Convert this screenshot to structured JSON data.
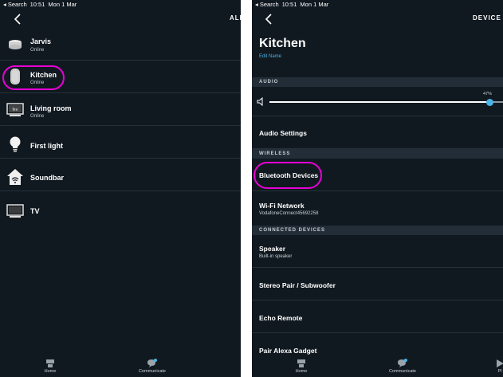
{
  "status_bar": {
    "carrier": "◂ Search",
    "time": "10:51",
    "date": "Mon 1 Mar"
  },
  "left": {
    "header_action": "ALL",
    "devices": [
      {
        "name": "Jarvis",
        "status": "Online",
        "icon": "echo-dot-icon"
      },
      {
        "name": "Kitchen",
        "status": "Online",
        "icon": "echo-speaker-icon"
      },
      {
        "name": "Living room",
        "status": "Online",
        "icon": "fire-tv-icon"
      },
      {
        "name": "First light",
        "status": "",
        "icon": "light-bulb-icon"
      },
      {
        "name": "Soundbar",
        "status": "",
        "icon": "home-wifi-icon"
      },
      {
        "name": "TV",
        "status": "",
        "icon": "tv-icon"
      }
    ]
  },
  "right": {
    "header_action": "DEVICE S",
    "title": "Kitchen",
    "edit_name": "Edit Name",
    "audio_section": "AUDIO",
    "volume": {
      "value": 47,
      "label": "47%"
    },
    "audio_settings": "Audio Settings",
    "wireless_section": "WIRELESS",
    "bluetooth": "Bluetooth Devices",
    "wifi": {
      "label": "Wi-Fi Network",
      "network": "VodafoneConnect45692258"
    },
    "connected_section": "CONNECTED DEVICES",
    "speaker": {
      "label": "Speaker",
      "sub": "Built-in speaker"
    },
    "stereo": "Stereo Pair / Subwoofer",
    "echo_remote": "Echo Remote",
    "pair_gadget": "Pair Alexa Gadget"
  },
  "tabs": {
    "home": "Home",
    "communicate": "Communicate",
    "play_partial": "Pl"
  },
  "colors": {
    "background": "#111920",
    "accent": "#4ab3e8",
    "highlight_circle": "#e600d6"
  }
}
